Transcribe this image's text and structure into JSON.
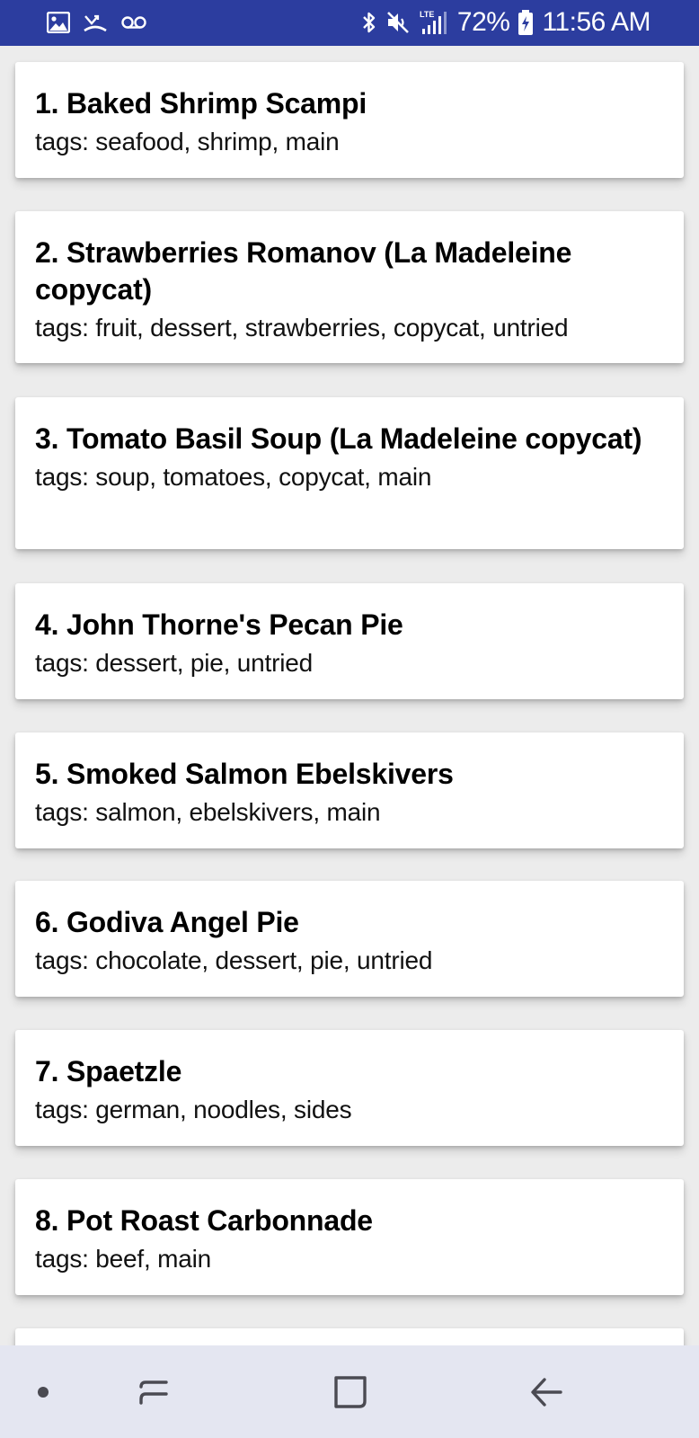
{
  "status_bar": {
    "left_icons": [
      "image-icon",
      "missed-call-icon",
      "voicemail-icon"
    ],
    "right_icons": [
      "bluetooth-icon",
      "mute-icon",
      "lte-signal-icon"
    ],
    "battery_percent": "72%",
    "time": "11:56 AM"
  },
  "recipes": [
    {
      "title": "1. Baked Shrimp Scampi",
      "tags": "tags: seafood, shrimp, main"
    },
    {
      "title": "2. Strawberries Romanov (La Madeleine copycat)",
      "tags": "tags: fruit, dessert, strawberries, copycat, untried"
    },
    {
      "title": "3. Tomato Basil Soup (La Madeleine copycat)",
      "tags": "tags: soup, tomatoes, copycat, main"
    },
    {
      "title": "4. John Thorne's Pecan Pie",
      "tags": "tags: dessert, pie, untried"
    },
    {
      "title": "5. Smoked Salmon Ebelskivers",
      "tags": "tags: salmon, ebelskivers, main"
    },
    {
      "title": "6. Godiva Angel Pie",
      "tags": "tags: chocolate, dessert, pie, untried"
    },
    {
      "title": "7. Spaetzle",
      "tags": "tags: german, noodles, sides"
    },
    {
      "title": "8. Pot Roast Carbonnade",
      "tags": "tags: beef, main"
    }
  ],
  "nav_bar": {
    "icons": [
      "dot-icon",
      "recents-icon",
      "home-icon",
      "back-icon"
    ]
  }
}
